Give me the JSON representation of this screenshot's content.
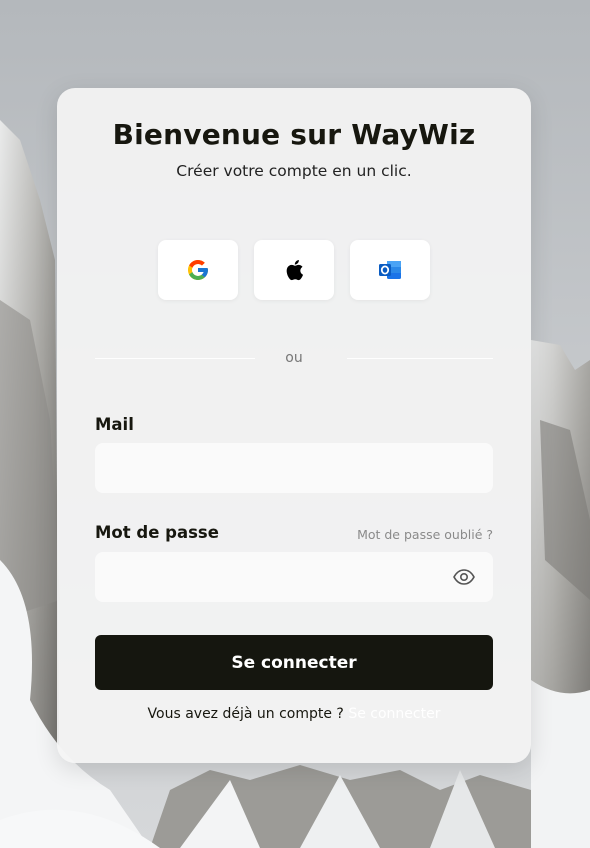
{
  "card": {
    "title": "Bienvenue sur WayWiz",
    "subtitle": "Créer votre compte en un clic."
  },
  "social": [
    {
      "icon": "google-icon"
    },
    {
      "icon": "apple-icon"
    },
    {
      "icon": "outlook-icon"
    }
  ],
  "divider": {
    "label": "ou"
  },
  "form": {
    "mail_label": "Mail",
    "mail_value": "",
    "password_label": "Mot de passe",
    "password_value": "",
    "forgot_label": "Mot de passe oublié ?",
    "submit_label": "Se connecter"
  },
  "footer": {
    "text": "Vous avez déjà un compte ?",
    "link": "Se connecter"
  },
  "colors": {
    "primary_button": "#15160f",
    "text": "#17170f",
    "link": "#ffffff"
  }
}
